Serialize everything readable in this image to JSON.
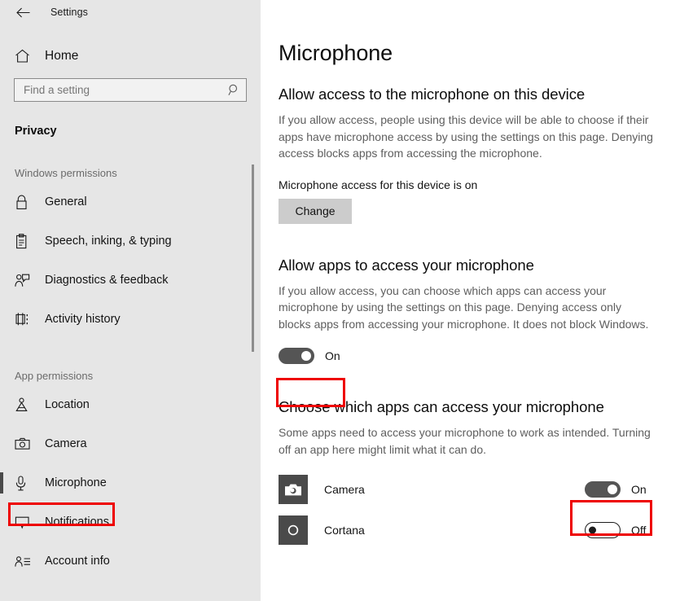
{
  "window": {
    "back_icon": "back-arrow-icon",
    "title": "Settings"
  },
  "sidebar": {
    "home": {
      "icon": "home-icon",
      "label": "Home"
    },
    "search": {
      "icon": "search-icon",
      "placeholder": "Find a setting",
      "value": ""
    },
    "category_title": "Privacy",
    "groups": [
      {
        "header": "Windows permissions",
        "items": [
          {
            "icon": "lock-icon",
            "label": "General",
            "selected": false
          },
          {
            "icon": "clipboard-icon",
            "label": "Speech, inking, & typing",
            "selected": false
          },
          {
            "icon": "feedback-icon",
            "label": "Diagnostics & feedback",
            "selected": false
          },
          {
            "icon": "timeline-icon",
            "label": "Activity history",
            "selected": false
          }
        ]
      },
      {
        "header": "App permissions",
        "items": [
          {
            "icon": "location-icon",
            "label": "Location",
            "selected": false
          },
          {
            "icon": "camera-icon",
            "label": "Camera",
            "selected": false
          },
          {
            "icon": "microphone-icon",
            "label": "Microphone",
            "selected": true
          },
          {
            "icon": "notification-icon",
            "label": "Notifications",
            "selected": false
          },
          {
            "icon": "account-icon",
            "label": "Account info",
            "selected": false
          }
        ]
      }
    ]
  },
  "main": {
    "page_title": "Microphone",
    "section_device": {
      "heading": "Allow access to the microphone on this device",
      "description": "If you allow access, people using this device will be able to choose if their apps have microphone access by using the settings on this page. Denying access blocks apps from accessing the microphone.",
      "status": "Microphone access for this device is on",
      "change_label": "Change"
    },
    "section_apps": {
      "heading": "Allow apps to access your microphone",
      "description": "If you allow access, you can choose which apps can access your microphone by using the settings on this page. Denying access only blocks apps from accessing your microphone. It does not block Windows.",
      "toggle_state": "On"
    },
    "section_choose": {
      "heading": "Choose which apps can access your microphone",
      "description": "Some apps need to access your microphone to work as intended. Turning off an app here might limit what it can do.",
      "apps": [
        {
          "icon": "camera-app-icon",
          "name": "Camera",
          "toggle_state": "On"
        },
        {
          "icon": "cortana-app-icon",
          "name": "Cortana",
          "toggle_state": "Off"
        }
      ]
    }
  },
  "annotations": {
    "highlight_color": "#ee0000",
    "boxes": [
      "sidebar-microphone-item",
      "allow-apps-toggle",
      "camera-app-toggle"
    ]
  }
}
